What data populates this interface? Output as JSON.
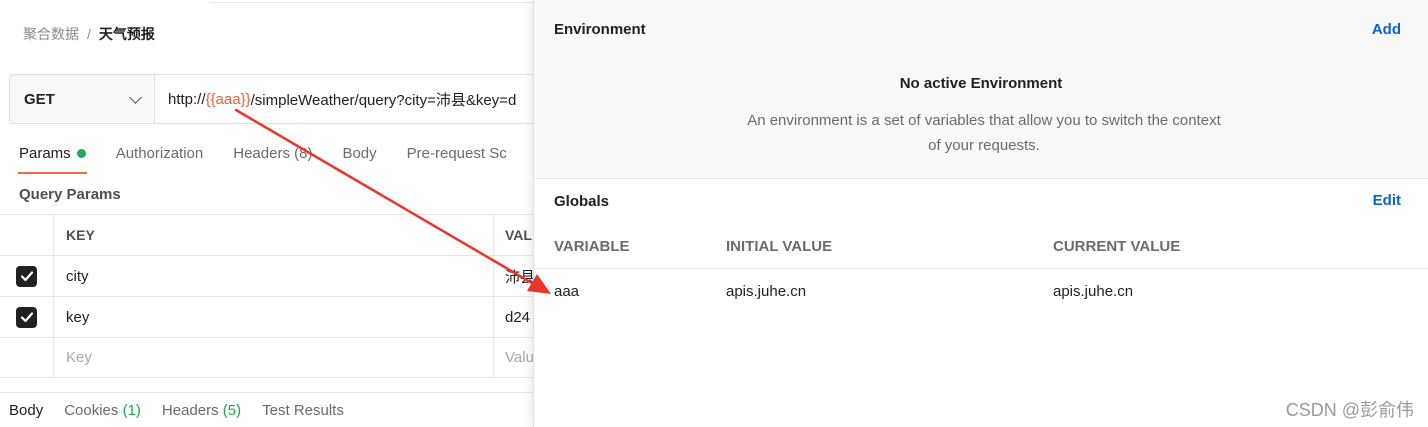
{
  "breadcrumb": {
    "parent": "聚合数据",
    "separator": "/",
    "current": "天气预报"
  },
  "request": {
    "method": "GET",
    "url_prefix": "http://",
    "url_var": "{{aaa}}",
    "url_rest": "/simpleWeather/query?city=沛县&key=d"
  },
  "tabs": [
    {
      "label": "Params"
    },
    {
      "label": "Authorization"
    },
    {
      "label": "Headers (8)"
    },
    {
      "label": "Body"
    },
    {
      "label": "Pre-request Sc"
    }
  ],
  "query_params": {
    "title": "Query Params",
    "headers": {
      "key": "KEY",
      "value": "VAL"
    },
    "rows": [
      {
        "key": "city",
        "value": "沛县"
      },
      {
        "key": "key",
        "value": "d24"
      }
    ],
    "placeholder": {
      "key": "Key",
      "value": "Valu"
    }
  },
  "bottom_tabs": {
    "body": "Body",
    "cookies": "Cookies",
    "cookies_count": "(1)",
    "headers": "Headers",
    "headers_count": "(5)",
    "test_results": "Test Results"
  },
  "environment_panel": {
    "title": "Environment",
    "add_label": "Add",
    "no_env_title": "No active Environment",
    "no_env_desc": "An environment is a set of variables that allow you to switch the context of your requests."
  },
  "globals": {
    "title": "Globals",
    "edit_label": "Edit",
    "columns": {
      "variable": "VARIABLE",
      "initial": "INITIAL VALUE",
      "current": "CURRENT VALUE"
    },
    "rows": [
      {
        "variable": "aaa",
        "initial": "apis.juhe.cn",
        "current": "apis.juhe.cn"
      }
    ]
  },
  "watermark": "CSDN @彭俞伟",
  "colors": {
    "accent_orange": "#f26b3a",
    "link_blue": "#0b66c3",
    "success_green": "#23a55a",
    "annotation_arrow": "#e8362a"
  }
}
